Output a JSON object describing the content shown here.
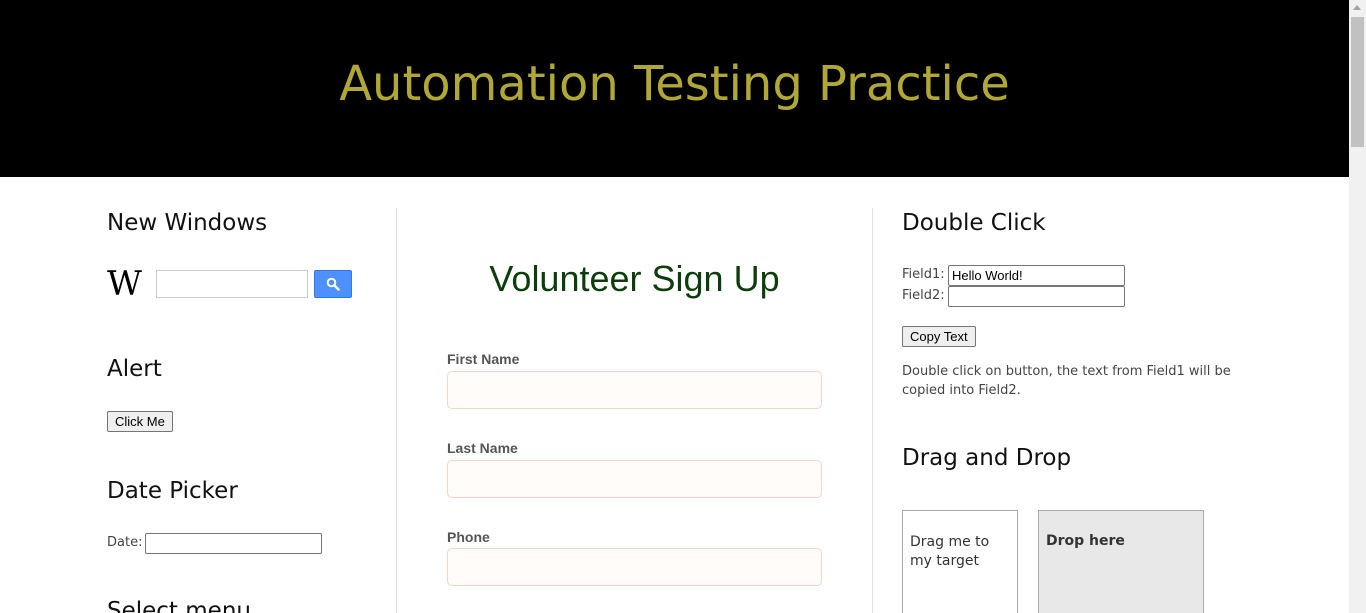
{
  "header": {
    "title": "Automation Testing Practice"
  },
  "new_windows": {
    "heading": "New Windows",
    "logo_letter": "W",
    "search_placeholder": ""
  },
  "alert": {
    "heading": "Alert",
    "button_label": "Click Me"
  },
  "date_picker": {
    "heading": "Date Picker",
    "date_label": "Date:",
    "date_value": ""
  },
  "select_menu": {
    "heading": "Select menu"
  },
  "volunteer_form": {
    "title": "Volunteer Sign Up",
    "fields": [
      {
        "label": "First Name",
        "value": ""
      },
      {
        "label": "Last Name",
        "value": ""
      },
      {
        "label": "Phone",
        "value": ""
      }
    ]
  },
  "double_click": {
    "heading": "Double Click",
    "field1_label": "Field1:",
    "field1_value": "Hello World!",
    "field2_label": "Field2:",
    "field2_value": "",
    "copy_button": "Copy Text",
    "description": "Double click on button, the text from Field1 will be copied into Field2."
  },
  "drag_drop": {
    "heading": "Drag and Drop",
    "draggable_text": "Drag me to my target",
    "droppable_text": "Drop here"
  },
  "colors": {
    "header_bg": "#000000",
    "header_title": "#b0a736",
    "form_title": "#0c3d0c",
    "search_button": "#4d90fe"
  }
}
